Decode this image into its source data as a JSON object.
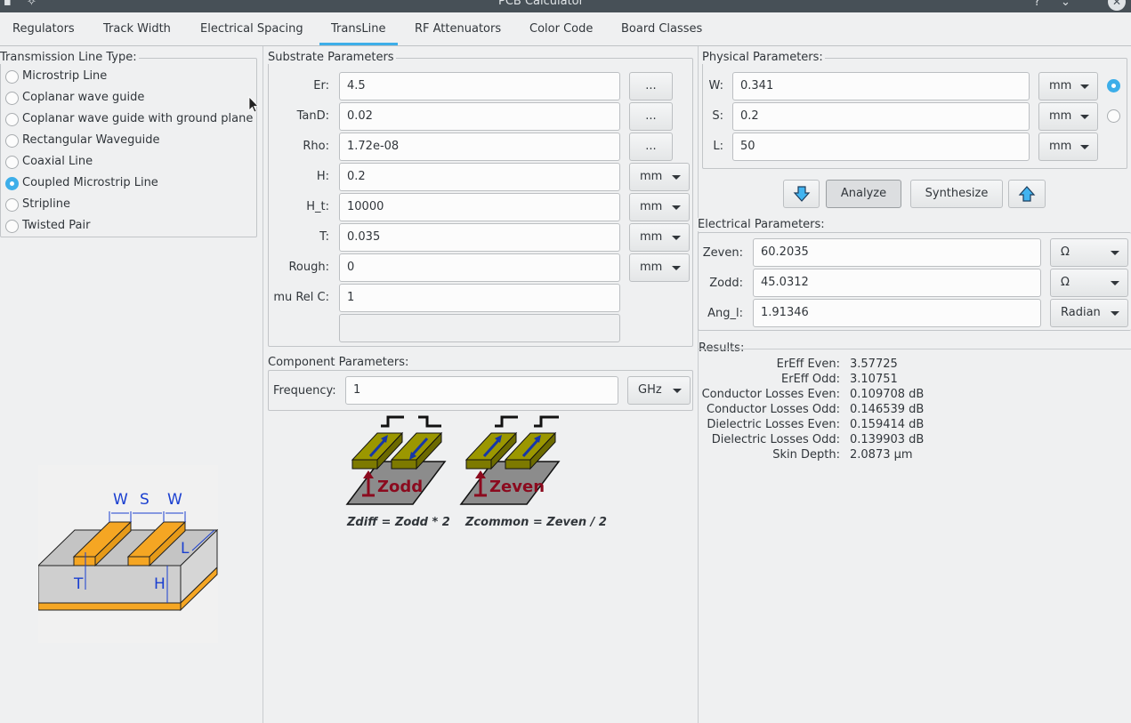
{
  "window": {
    "title": "PCB Calculator"
  },
  "tabs": [
    "Regulators",
    "Track Width",
    "Electrical Spacing",
    "TransLine",
    "RF Attenuators",
    "Color Code",
    "Board Classes"
  ],
  "line_type": {
    "title": "Transmission Line Type:",
    "options": [
      "Microstrip Line",
      "Coplanar wave guide",
      "Coplanar wave guide with ground plane",
      "Rectangular Waveguide",
      "Coaxial Line",
      "Coupled Microstrip Line",
      "Stripline",
      "Twisted Pair"
    ],
    "selected": "Coupled Microstrip Line"
  },
  "substrate": {
    "title": "Substrate Parameters",
    "rows": [
      {
        "label": "Er:",
        "value": "4.5",
        "action": "..."
      },
      {
        "label": "TanD:",
        "value": "0.02",
        "action": "..."
      },
      {
        "label": "Rho:",
        "value": "1.72e-08",
        "action": "..."
      },
      {
        "label": "H:",
        "value": "0.2",
        "unit": "mm"
      },
      {
        "label": "H_t:",
        "value": "10000",
        "unit": "mm"
      },
      {
        "label": "T:",
        "value": "0.035",
        "unit": "mm"
      },
      {
        "label": "Rough:",
        "value": "0",
        "unit": "mm"
      },
      {
        "label": "mu Rel C:",
        "value": "1"
      }
    ]
  },
  "component": {
    "title": "Component Parameters:",
    "freq_label": "Frequency:",
    "freq_value": "1",
    "freq_unit": "GHz"
  },
  "physical": {
    "title": "Physical Parameters:",
    "rows": [
      {
        "label": "W:",
        "value": "0.341",
        "unit": "mm",
        "selected": true
      },
      {
        "label": "S:",
        "value": "0.2",
        "unit": "mm",
        "selected": false
      },
      {
        "label": "L:",
        "value": "50",
        "unit": "mm"
      }
    ]
  },
  "actions": {
    "analyze": "Analyze",
    "synthesize": "Synthesize",
    "down_icon": "arrow-down-icon",
    "up_icon": "arrow-up-icon"
  },
  "electrical": {
    "title": "Electrical Parameters:",
    "rows": [
      {
        "label": "Zeven:",
        "value": "60.2035",
        "unit": "Ω"
      },
      {
        "label": "Zodd:",
        "value": "45.0312",
        "unit": "Ω"
      },
      {
        "label": "Ang_l:",
        "value": "1.91346",
        "unit": "Radian"
      }
    ]
  },
  "results": {
    "title": "Results:",
    "rows": [
      {
        "label": "ErEff Even:",
        "value": "3.57725"
      },
      {
        "label": "ErEff Odd:",
        "value": "3.10751"
      },
      {
        "label": "Conductor Losses Even:",
        "value": "0.109708 dB"
      },
      {
        "label": "Conductor Losses Odd:",
        "value": "0.146539 dB"
      },
      {
        "label": "Dielectric Losses Even:",
        "value": "0.159414 dB"
      },
      {
        "label": "Dielectric Losses Odd:",
        "value": "0.139903 dB"
      },
      {
        "label": "Skin Depth:",
        "value": "2.0873 µm"
      }
    ]
  },
  "diagrams": {
    "zodd_label": "Zodd",
    "zeven_label": "Zeven",
    "formula_diff": "Zdiff = Zodd * 2",
    "formula_common": "Zcommon = Zeven / 2",
    "dim_w1": "W",
    "dim_s": "S",
    "dim_w2": "W",
    "dim_l": "L",
    "dim_t": "T",
    "dim_h": "H"
  },
  "colors": {
    "accent": "#3daee9",
    "copper": "#f5a623",
    "olive": "#8d8b00",
    "trace_blue": "#1636a8",
    "marker_red": "#8b0a1e"
  }
}
